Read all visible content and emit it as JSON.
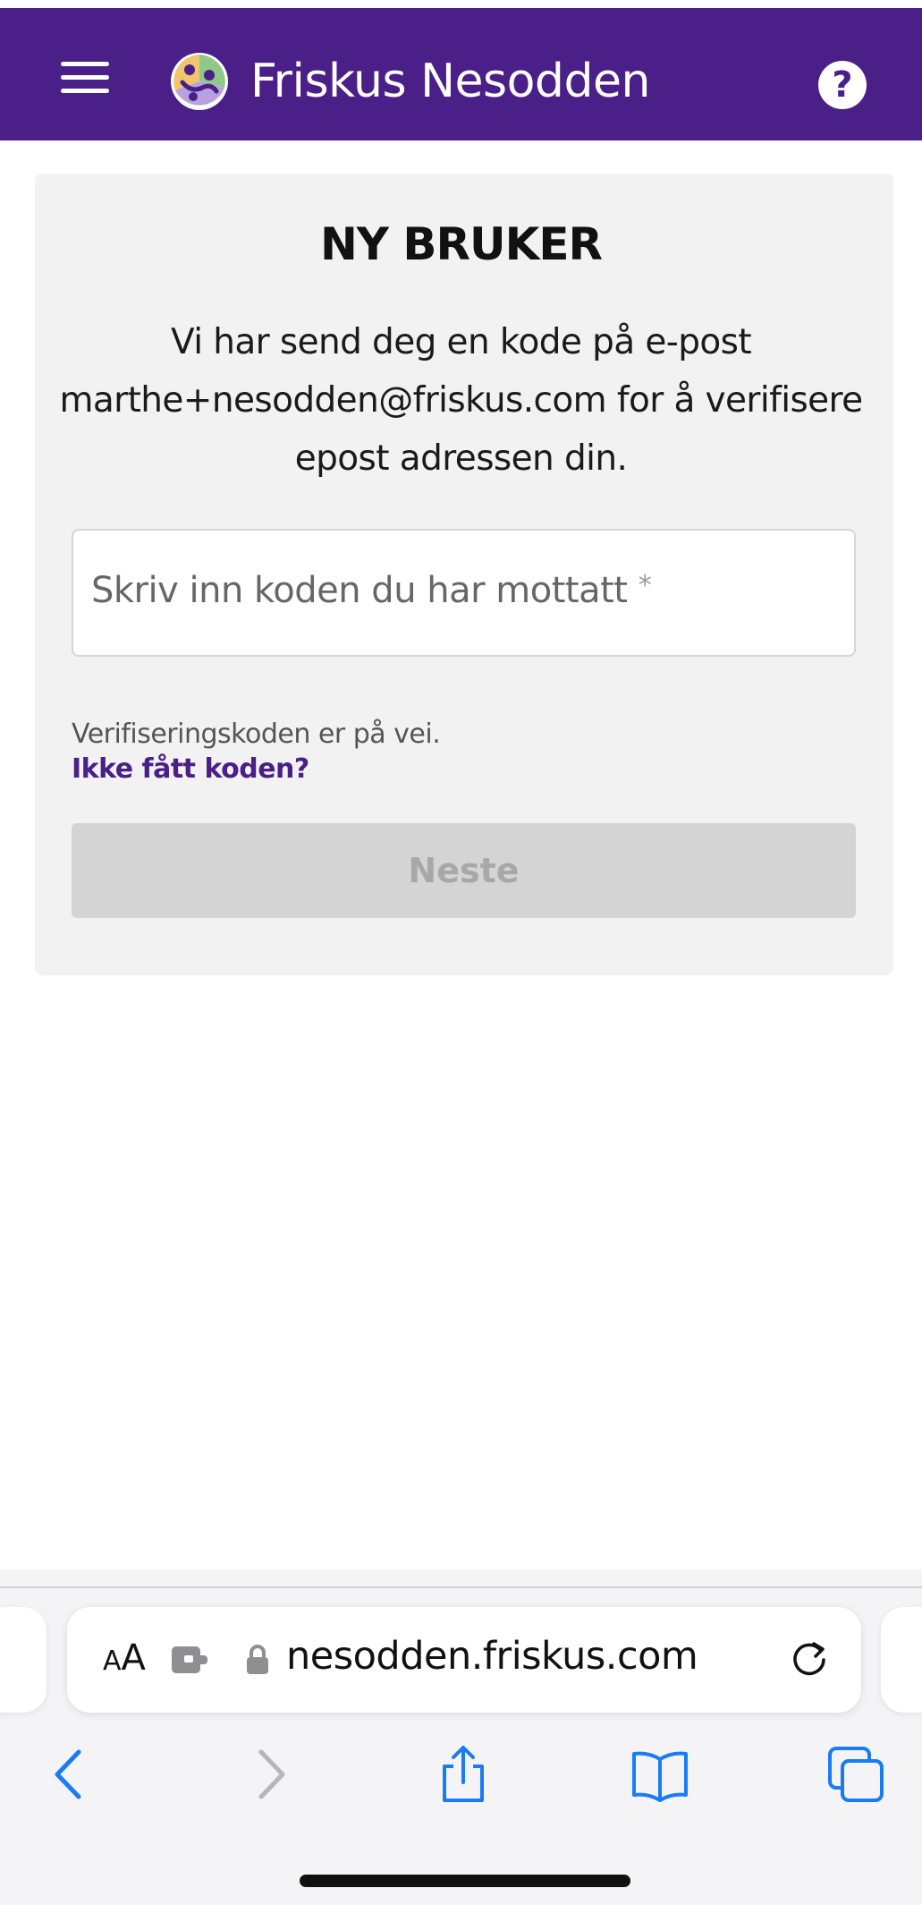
{
  "header": {
    "brand": "Friskus Nesodden",
    "help_label": "?"
  },
  "card": {
    "title": "NY BRUKER",
    "message": "Vi har send deg en kode på e-post marthe+nesodden@friskus.com for å verifisere epost adressen din.",
    "code_input": {
      "placeholder": "Skriv inn koden du har mottatt",
      "required_marker": "*",
      "value": ""
    },
    "status_text": "Verifiseringskoden er på vei.",
    "resend_link": "Ikke fått koden?",
    "next_button": "Neste"
  },
  "browser": {
    "text_size_label_small": "A",
    "text_size_label_large": "A",
    "url": "nesodden.friskus.com"
  },
  "colors": {
    "brand_purple": "#4a1f87",
    "button_disabled": "#d4d4d4",
    "ios_blue": "#1a7cf5"
  }
}
